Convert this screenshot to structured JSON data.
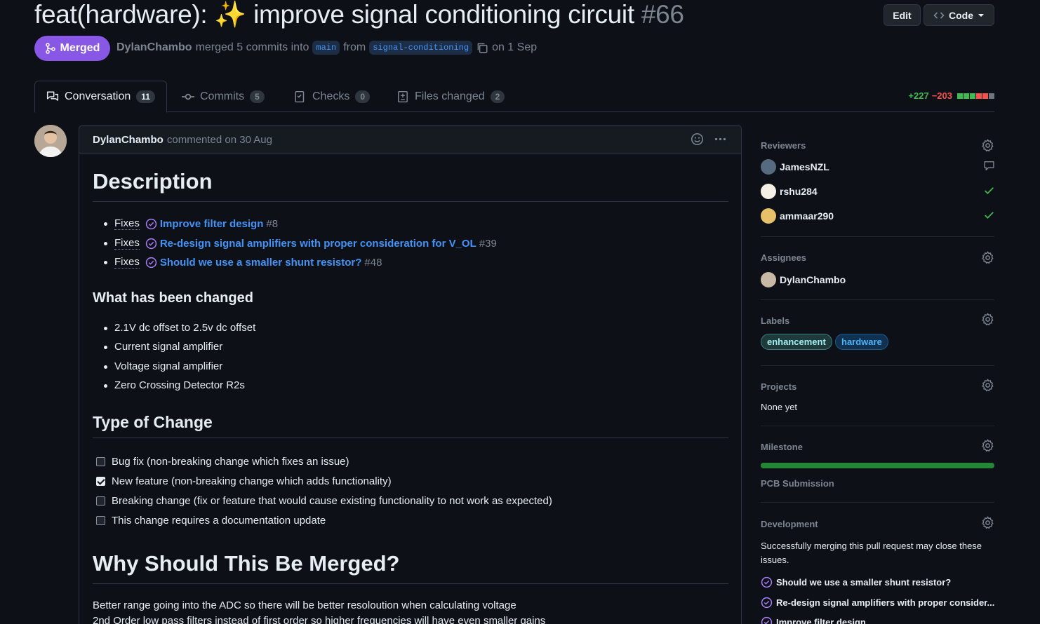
{
  "header": {
    "title": "feat(hardware): ✨ improve signal conditioning circuit",
    "number": "#66",
    "edit_label": "Edit",
    "code_label": "Code",
    "state_label": "Merged",
    "author": "DylanChambo",
    "merged_text": "merged 5 commits into",
    "base_branch": "main",
    "from_text": "from",
    "head_branch": "signal-conditioning",
    "date_text": "on 1 Sep"
  },
  "tabs": [
    {
      "label": "Conversation",
      "count": "11"
    },
    {
      "label": "Commits",
      "count": "5"
    },
    {
      "label": "Checks",
      "count": "0"
    },
    {
      "label": "Files changed",
      "count": "2"
    }
  ],
  "diffstat": {
    "additions": "+227",
    "deletions": "−203"
  },
  "comment": {
    "author": "DylanChambo",
    "meta": "commented on 30 Aug",
    "description_heading": "Description",
    "fixes": [
      {
        "prefix": "Fixes",
        "title": "Improve filter design",
        "number": "#8"
      },
      {
        "prefix": "Fixes",
        "title": "Re-design signal amplifiers with proper consideration for V_OL",
        "number": "#39"
      },
      {
        "prefix": "Fixes",
        "title": "Should we use a smaller shunt resistor?",
        "number": "#48"
      }
    ],
    "changed_heading": "What has been changed",
    "changes": [
      "2.1V dc offset to 2.5v dc offset",
      "Current signal amplifier",
      "Voltage signal amplifier",
      "Zero Crossing Detector R2s"
    ],
    "type_heading": "Type of Change",
    "types": [
      {
        "label": "Bug fix (non-breaking change which fixes an issue)",
        "checked": false
      },
      {
        "label": "New feature (non-breaking change which adds functionality)",
        "checked": true
      },
      {
        "label": "Breaking change (fix or feature that would cause existing functionality to not work as expected)",
        "checked": false
      },
      {
        "label": "This change requires a documentation update",
        "checked": false
      }
    ],
    "why_heading": "Why Should This Be Merged?",
    "why_lines": [
      "Better range going into the ADC so there will be better resoloution when calculating voltage",
      "2nd Order low pass filters instead of first order so higher frequencies will have even smaller gains"
    ]
  },
  "sidebar": {
    "reviewers_heading": "Reviewers",
    "reviewers": [
      {
        "name": "JamesNZL",
        "status": "comment-icon"
      },
      {
        "name": "rshu284",
        "status": "check-icon"
      },
      {
        "name": "ammaar290",
        "status": "check-icon"
      }
    ],
    "assignees_heading": "Assignees",
    "assignees": [
      "DylanChambo"
    ],
    "labels_heading": "Labels",
    "labels": [
      {
        "name": "enhancement",
        "color": "#a2eeef"
      },
      {
        "name": "hardware",
        "color": "#1d76db"
      }
    ],
    "projects_heading": "Projects",
    "projects_value": "None yet",
    "milestone_heading": "Milestone",
    "milestone_progress": 1.0,
    "milestone_name": "PCB Submission",
    "development_heading": "Development",
    "development_text": "Successfully merging this pull request may close these issues.",
    "development_issues": [
      "Should we use a smaller shunt resistor?",
      "Re-design signal amplifiers with proper consider...",
      "Improve filter design"
    ]
  },
  "colors": {
    "merged": "#8957e5",
    "link": "#4493f8",
    "success": "#3fb950",
    "danger": "#f85149"
  }
}
